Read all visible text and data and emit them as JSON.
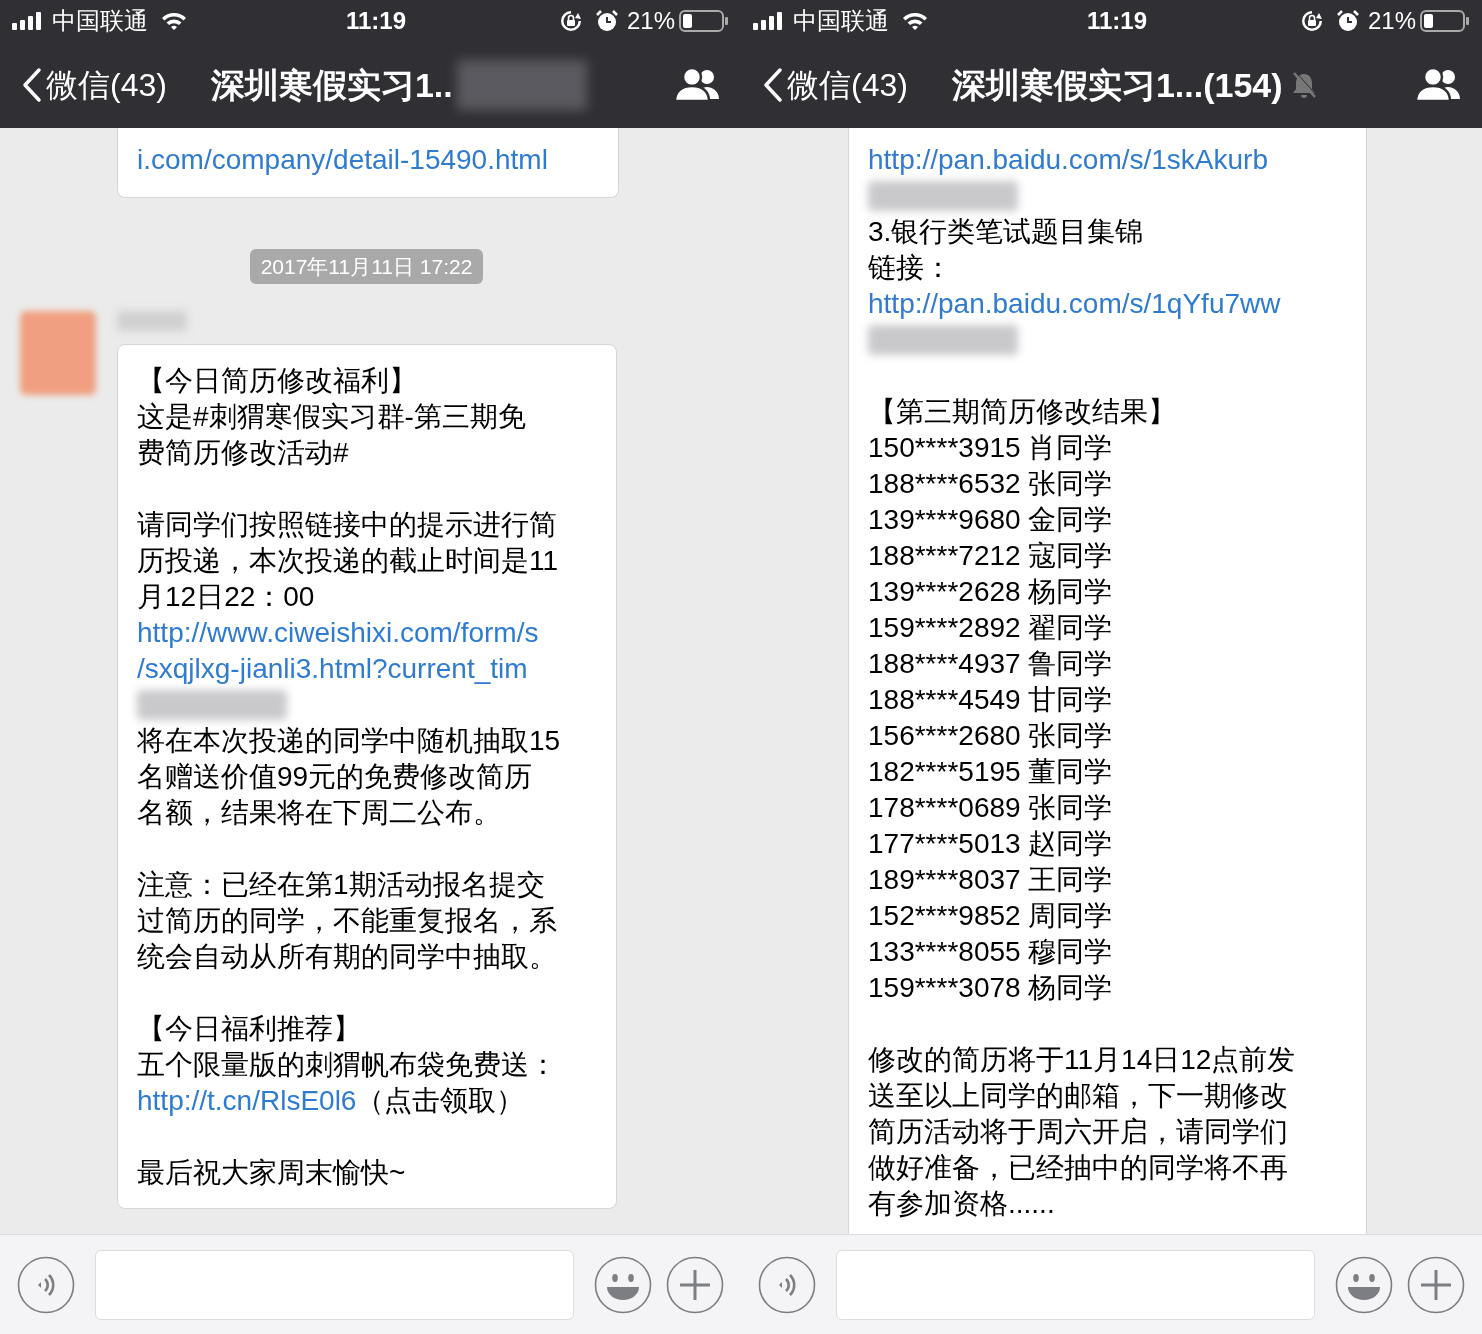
{
  "panels": [
    {
      "status_bar": {
        "carrier": "中国联通",
        "time": "11:19",
        "battery": "21%"
      },
      "nav": {
        "back": "微信(43)",
        "title": "深圳寒假实习1..",
        "title_redacted": true,
        "muted": false
      },
      "messages": [
        {
          "kind": "bubble",
          "sender": false,
          "sections": [
            [
              {
                "kind": "link",
                "lines": [
                  "i.com/company/detail-15490.html"
                ]
              }
            ]
          ]
        },
        {
          "kind": "time",
          "text": "2017年11月11日 17:22"
        },
        {
          "kind": "bubble",
          "sender": true,
          "sections": [
            [
              {
                "kind": "text",
                "lines": [
                  "【今日简历修改福利】",
                  "这是#刺猬寒假实习群-第三期免",
                  "费简历修改活动#"
                ]
              }
            ],
            [
              {
                "kind": "text",
                "lines": [
                  "请同学们按照链接中的提示进行简",
                  "历投递，本次投递的截止时间是11",
                  "月12日22：00"
                ]
              },
              {
                "kind": "link",
                "lines": [
                  "http://www.ciweishixi.com/form/s",
                  "/sxqjlxg-jianli3.html?current_tim"
                ]
              },
              {
                "kind": "redacted"
              },
              {
                "kind": "text",
                "lines": [
                  "将在本次投递的同学中随机抽取15",
                  "名赠送价值99元的免费修改简历",
                  "名额，结果将在下周二公布。"
                ]
              }
            ],
            [
              {
                "kind": "text",
                "lines": [
                  "注意：已经在第1期活动报名提交",
                  "过简历的同学，不能重复报名，系",
                  "统会自动从所有期的同学中抽取。"
                ]
              }
            ],
            [
              {
                "kind": "text",
                "lines": [
                  "【今日福利推荐】",
                  "五个限量版的刺猬帆布袋免费送："
                ]
              },
              {
                "kind": "linked",
                "link": "http://t.cn/RlsE0l6",
                "text": "（点击领取）"
              }
            ],
            [
              {
                "kind": "text",
                "lines": [
                  "最后祝大家周末愉快~"
                ]
              }
            ]
          ]
        }
      ]
    },
    {
      "status_bar": {
        "carrier": "中国联通",
        "time": "11:19",
        "battery": "21%"
      },
      "nav": {
        "back": "微信(43)",
        "title": "深圳寒假实习1...(154)",
        "title_redacted": false,
        "muted": true
      },
      "messages": [
        {
          "kind": "bubble",
          "sender": false,
          "sections": [
            [
              {
                "kind": "link",
                "lines": [
                  "http://pan.baidu.com/s/1skAkurb"
                ]
              },
              {
                "kind": "redacted"
              },
              {
                "kind": "text",
                "lines": [
                  "3.银行类笔试题目集锦",
                  "链接："
                ]
              },
              {
                "kind": "link",
                "lines": [
                  "http://pan.baidu.com/s/1qYfu7ww"
                ]
              },
              {
                "kind": "redacted"
              }
            ],
            [
              {
                "kind": "text",
                "lines": [
                  "【第三期简历修改结果】",
                  "150****3915 肖同学",
                  "188****6532 张同学",
                  "139****9680 金同学",
                  "188****7212 寇同学",
                  "139****2628 杨同学",
                  "159****2892 翟同学",
                  "188****4937 鲁同学",
                  "188****4549 甘同学",
                  "156****2680 张同学",
                  "182****5195 董同学",
                  "178****0689 张同学",
                  "177****5013 赵同学",
                  "189****8037 王同学",
                  "152****9852 周同学",
                  "133****8055 穆同学",
                  "159****3078 杨同学"
                ]
              }
            ],
            [
              {
                "kind": "text",
                "lines": [
                  "修改的简历将于11月14日12点前发",
                  "送至以上同学的邮箱，下一期修改",
                  "简历活动将于周六开启，请同学们",
                  "做好准备，已经抽中的同学将不再",
                  "有参加资格......"
                ]
              }
            ]
          ]
        }
      ]
    }
  ]
}
